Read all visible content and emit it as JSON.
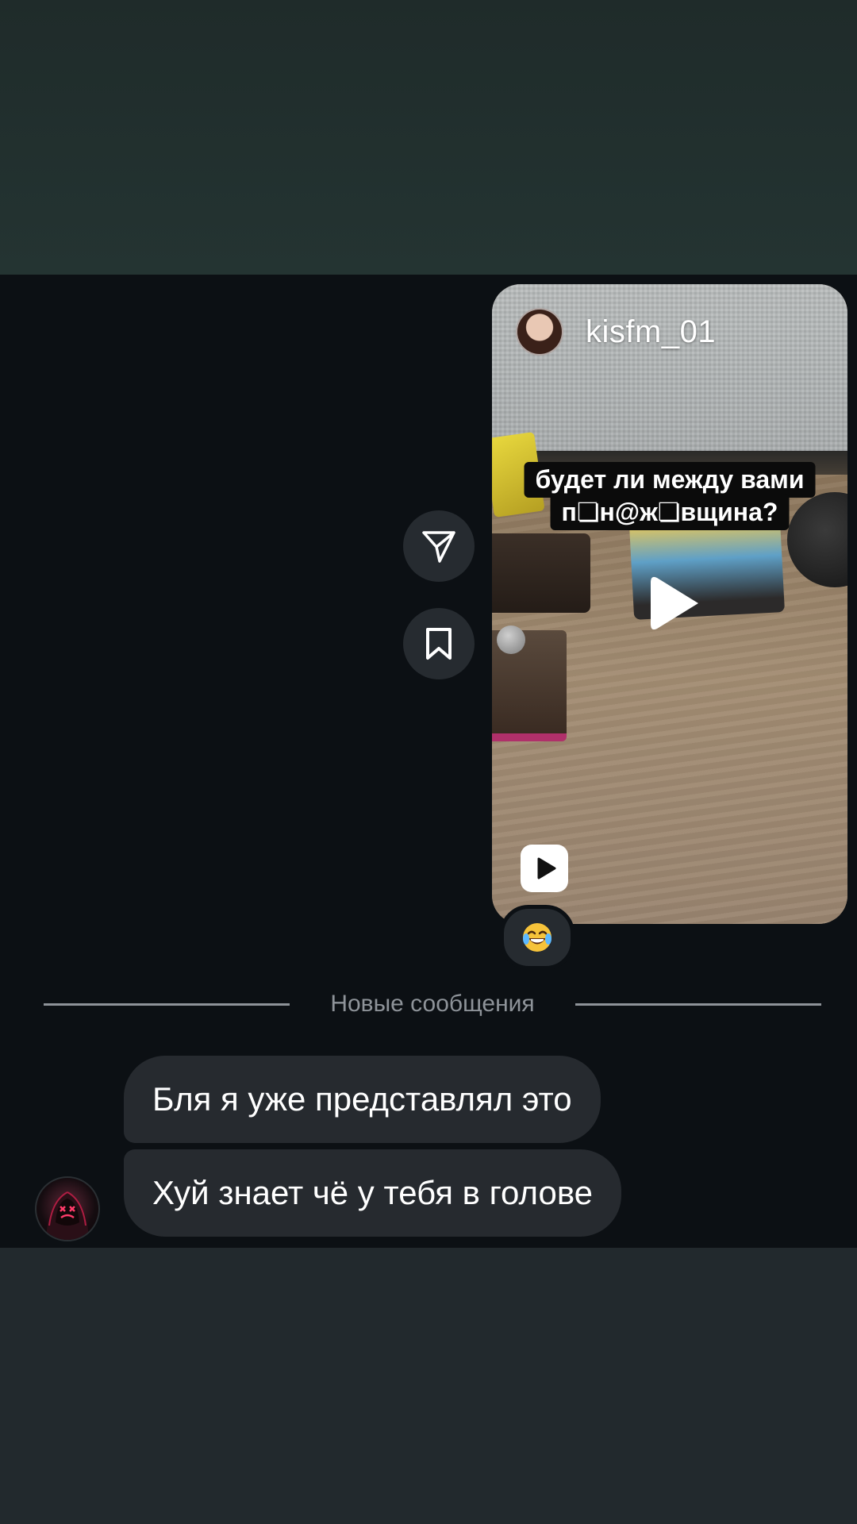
{
  "reel": {
    "username": "kisfm_01",
    "caption_line1": "будет ли между вами",
    "caption_line2": "п❏н@ж❏вщина?"
  },
  "reaction": {
    "emoji": "😂"
  },
  "divider": {
    "label": "Новые сообщения"
  },
  "messages": [
    {
      "text": "Бля я уже представлял это"
    },
    {
      "text": "Хуй знает чё у тебя в голове"
    }
  ],
  "colors": {
    "chat_background": "#0c1014",
    "bubble_background": "#262a2f",
    "divider_text": "#8e9399"
  }
}
